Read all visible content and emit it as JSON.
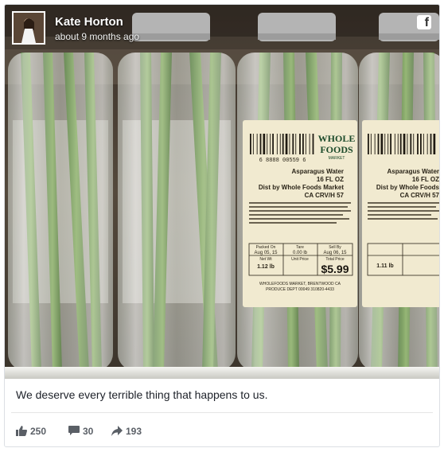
{
  "post": {
    "author_name": "Kate Horton",
    "timestamp": "about 9 months ago",
    "source_icon": "facebook-icon",
    "source_icon_glyph": "f",
    "caption": "We deserve every terrible thing that happens to us."
  },
  "photo_labels": {
    "brand_line1": "WHOLE",
    "brand_line2": "FOODS",
    "brand_line3": "MARKET",
    "barcode_number": "6 8888 00559 6",
    "product": "Asparagus Water",
    "volume": "16 FL OZ",
    "distributor": "Dist by Whole Foods Market",
    "store_code": "CA CRV/H 57",
    "packed_label": "Packed On",
    "packed_date": "Aug 05, 15",
    "tare_label": "Tare",
    "tare_value": "0.00 lb",
    "sell_by_label": "Sell By",
    "sell_by_date": "Aug 06, 15",
    "net_wt_label": "Net Wt",
    "net_wt_value": "1.12 lb",
    "unit_price_label": "Unit Price",
    "total_price_label": "Total Price",
    "price": "$5.99",
    "footer_line1": "WHOLEFOODS MARKET, BRENTWOOD CA",
    "footer_line2": "PRODUCE DEPT 00049 310820-4433",
    "right_product": "Asparagus Water",
    "right_volume": "16 FL OZ",
    "right_distributor": "Dist by Whole Foods",
    "right_store_code": "CA CRV/H 57",
    "right_net_wt": "1.11 lb"
  },
  "stats": {
    "likes": "250",
    "comments": "30",
    "shares": "193"
  },
  "colors": {
    "label_bg": "#f1ead0",
    "asparagus": "#5e8a3a",
    "shelf_dark": "#2a2620",
    "cap": "#dcdcdc"
  }
}
